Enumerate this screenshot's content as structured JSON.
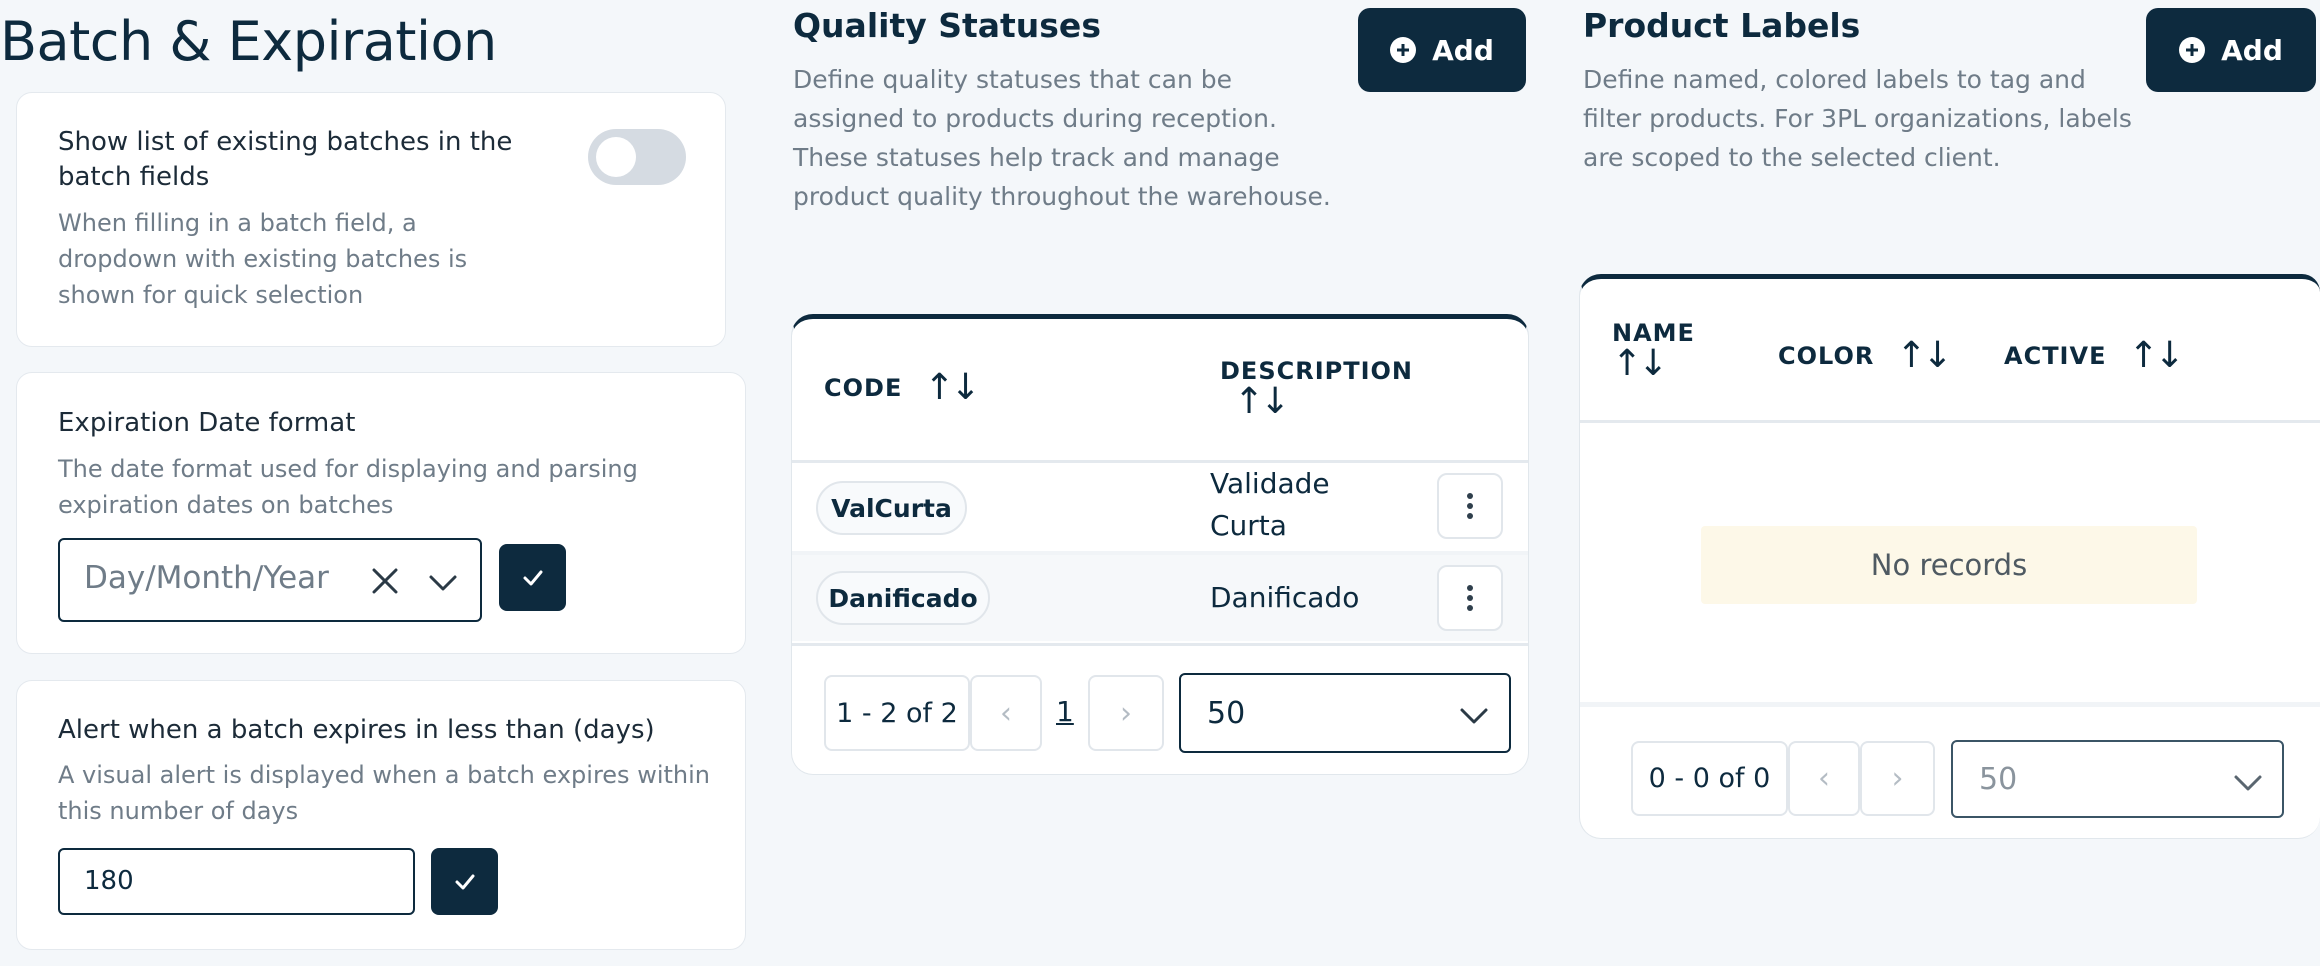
{
  "page": {
    "title": "Batch & Expiration"
  },
  "batch_list": {
    "title": "Show list of existing batches in the batch fields",
    "description": "When filling in a batch field, a dropdown with existing batches is shown for quick selection",
    "toggle_on": false
  },
  "expiration_format": {
    "title": "Expiration Date format",
    "description": "The date format used for displaying and parsing expiration dates on batches",
    "value": "Day/Month/Year"
  },
  "alert_days": {
    "title": "Alert when a batch expires in less than (days)",
    "description": "A visual alert is displayed when a batch expires within this number of days",
    "value": "180"
  },
  "quality_statuses": {
    "title": "Quality Statuses",
    "description": "Define quality statuses that can be assigned to products during reception. These statuses help track and manage product quality throughout the warehouse.",
    "add_label": "Add",
    "columns": {
      "code": "CODE",
      "description": "DESCRIPTION"
    },
    "rows": [
      {
        "code": "ValCurta",
        "description": "Validade Curta"
      },
      {
        "code": "Danificado",
        "description": "Danificado"
      }
    ],
    "pager": {
      "range": "1 - 2 of 2",
      "page": "1",
      "page_size": "50"
    }
  },
  "product_labels": {
    "title": "Product Labels",
    "description": "Define named, colored labels to tag and filter products. For 3PL organizations, labels are scoped to the selected client.",
    "add_label": "Add",
    "columns": {
      "name": "NAME",
      "color": "COLOR",
      "active": "ACTIVE"
    },
    "empty": "No records",
    "pager": {
      "range": "0 - 0 of 0",
      "page_size": "50"
    }
  },
  "icons": {
    "sort": "sort-arrows-icon",
    "clear": "close-icon",
    "dropdown": "chevron-down-icon",
    "confirm": "check-icon",
    "add": "plus-circle-icon",
    "row_menu": "kebab-menu-icon"
  },
  "colors": {
    "primary": "#0d2a3e",
    "muted": "#6f7c88",
    "empty_bg": "#fdf8e8"
  }
}
